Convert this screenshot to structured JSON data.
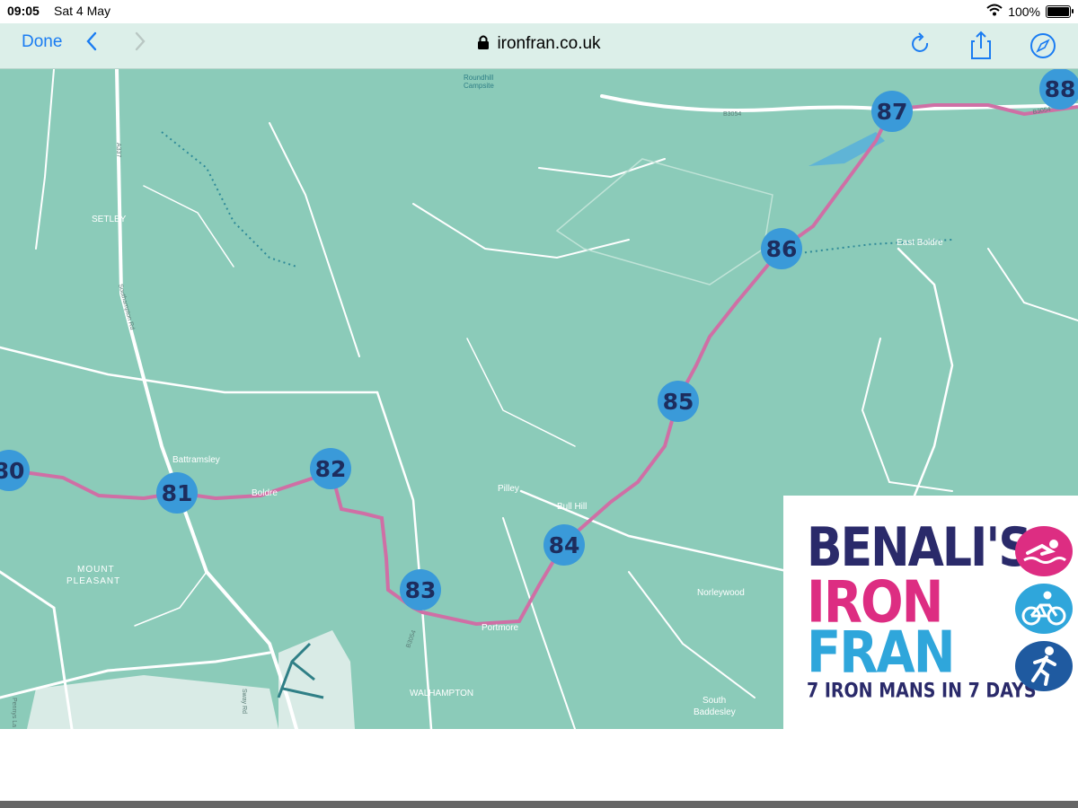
{
  "status_bar": {
    "time": "09:05",
    "date": "Sat 4 May",
    "battery": "100%",
    "battery_level": 1.0
  },
  "toolbar": {
    "done_label": "Done",
    "back_icon": "chevron-left-icon",
    "forward_icon": "chevron-right-icon",
    "url": "ironfran.co.uk",
    "reload_icon": "reload-icon",
    "share_icon": "share-icon",
    "safari_icon": "compass-icon"
  },
  "map": {
    "route_markers": [
      "80",
      "81",
      "82",
      "83",
      "84",
      "85",
      "86",
      "87",
      "88"
    ],
    "place_labels": [
      "SETLEY",
      "Battramsley",
      "Boldre",
      "MOUNT PLEASANT",
      "Pilley",
      "Bull Hill",
      "Portmore",
      "WALHAMPTON",
      "Norleywood",
      "South Baddesley",
      "East Boldre",
      "Roundhill Campsite"
    ],
    "road_labels": [
      "B3054",
      "A337",
      "Southampton Rd",
      "Sway Rd",
      "Pennys La",
      "B3054",
      "B3054"
    ],
    "colors": {
      "land": "#8bcbb9",
      "road": "#ffffff",
      "route": "#cf6fa5",
      "marker": "#3a9ad9",
      "marker_text": "#1d2d5e",
      "urban": "#d9ebe6"
    }
  },
  "logo": {
    "line1": "BENALI'S",
    "line2": "IRON",
    "line3": "FRAN",
    "tagline": "7 IRON MANS IN 7 DAYS",
    "icons": [
      "swim-icon",
      "bike-icon",
      "run-icon"
    ],
    "colors": {
      "navy": "#2a2a6a",
      "pink": "#dd2d82",
      "blue": "#2fa6db"
    }
  }
}
